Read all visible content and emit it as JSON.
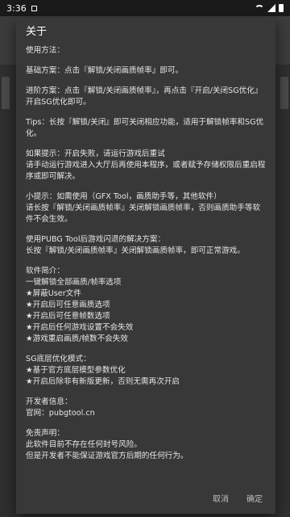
{
  "status_bar": {
    "time": "3:36",
    "colors": {
      "bg": "#1a1a1a",
      "fg": "#ffffff"
    }
  },
  "dialog": {
    "title": "关于",
    "sections": [
      [
        "使用方法："
      ],
      [
        "基础方案：点击『解锁/关闭画质帧率』即可。"
      ],
      [
        "进阶方案：点击『解锁/关闭画质帧率』，再点击『开启/关闭SG优化』开启SG优化即可。"
      ],
      [
        "Tips：长按『解锁/关闭』即可关闭相应功能，适用于解锁帧率和SG优化。"
      ],
      [
        "如果提示：开启失败，请运行游戏后重试",
        "请手动运行游戏进入大厅后再使用本程序，或者赋予存储权限后重启程序或即可解决。"
      ],
      [
        "小提示：如需使用（GFX Tool，画质助手等，其他软件）",
        "请长按『解锁/关闭画质帧率』关闭解锁画质帧率，否则画质助手等软件不会生效。"
      ],
      [
        "使用PUBG Tool后游戏闪退的解决方案：",
        "长按『解锁/关闭画质帧率』关闭解锁画质帧率，即可正常游戏。"
      ],
      [
        "软件简介：",
        "一键解锁全部画质/帧率选项",
        "★屏蔽User文件",
        "★开启后可任意画质选项",
        "★开启后可任意帧数选项",
        "★开启后任何游戏设置不会失效",
        "★游戏重启画质/帧数不会失效"
      ],
      [
        "SG底层优化模式：",
        "★基于官方底层模型参数优化",
        "★开启后除非有新版更新，否则无需再次开启"
      ],
      [
        "开发者信息：",
        "官网：pubgtool.cn"
      ],
      [
        "免责声明：",
        "此软件目前不存在任何封号风险。",
        "但是开发者不能保证游戏官方后期的任何行为。"
      ]
    ],
    "actions": {
      "left": "取消",
      "right": "确定"
    }
  }
}
